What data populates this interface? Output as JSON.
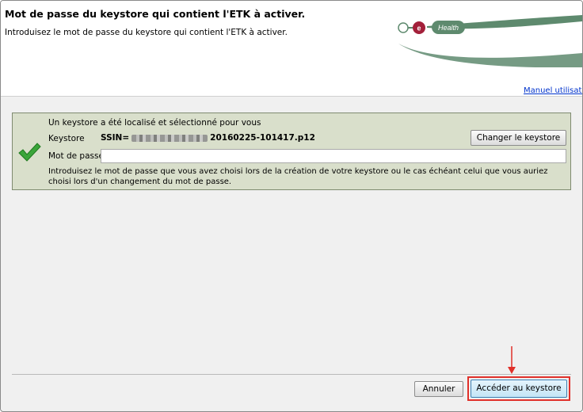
{
  "header": {
    "title": "Mot de passe du keystore qui contient l'ETK à activer.",
    "subtitle": "Introduisez le mot de passe du keystore qui contient l'ETK à activer.",
    "logo_text": "Health",
    "logo_letter": "e",
    "manual_link": "Manuel utilisateu"
  },
  "panel": {
    "found_text": "Un keystore a été localisé et sélectionné pour vous",
    "keystore_label": "Keystore",
    "keystore_prefix": "SSIN=",
    "keystore_suffix": "20160225-101417.p12",
    "change_button": "Changer le keystore",
    "password_label": "Mot de passe",
    "password_value": "",
    "help_text": "Introduisez le mot de passe que vous avez choisi lors de la création de votre keystore ou le cas échéant celui que vous auriez choisi lors d'un changement du mot de passe."
  },
  "footer": {
    "cancel_button": "Annuler",
    "access_button": "Accéder au keystore"
  },
  "colors": {
    "panel_bg": "#d9dfcb",
    "accent_red": "#e0302a",
    "logo_green": "#5e8a6e",
    "logo_red": "#a3203a",
    "link_blue": "#0033cc"
  }
}
